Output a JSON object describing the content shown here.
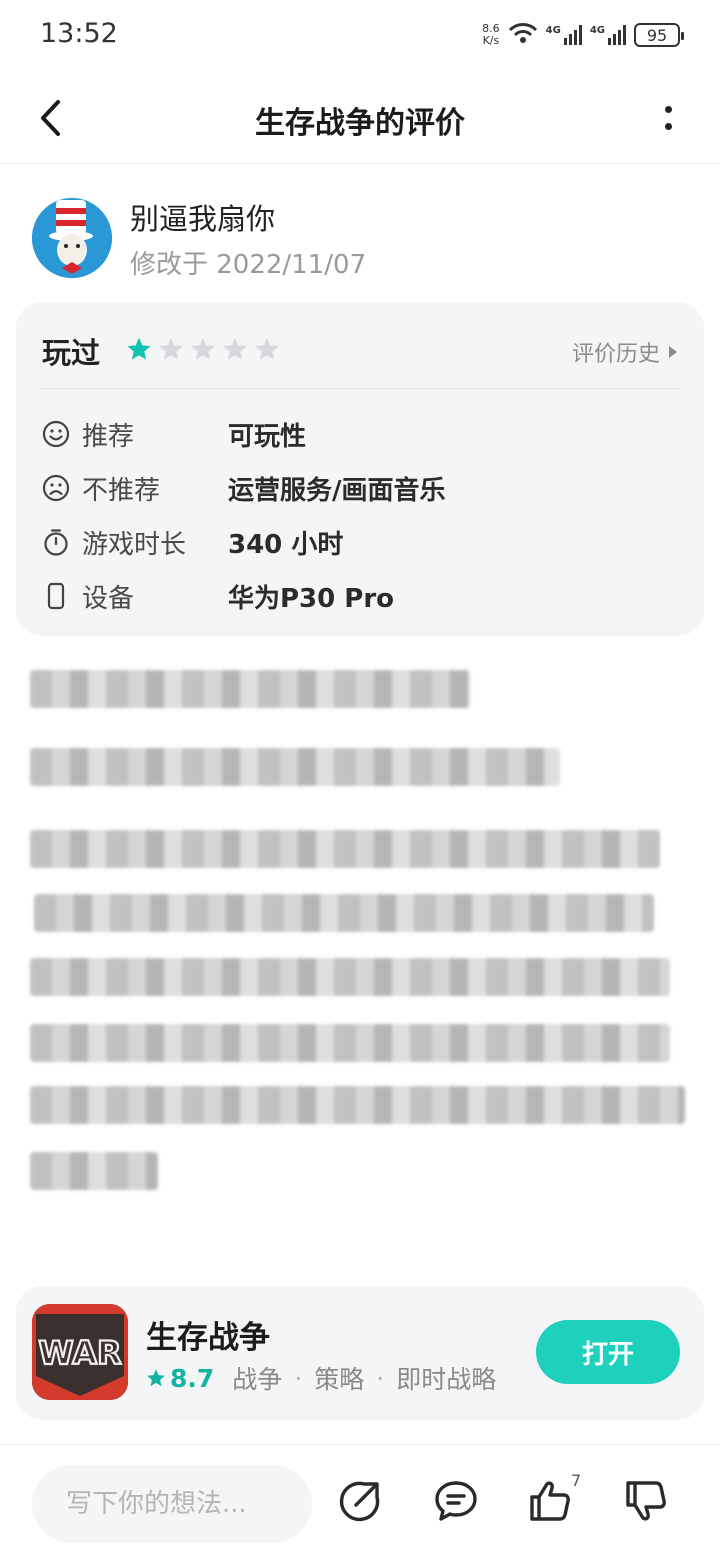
{
  "status_bar": {
    "time": "13:52",
    "net_speed_value": "8.6",
    "net_speed_unit": "K/s",
    "signal_1_label": "4G",
    "signal_2_label": "4G",
    "battery": "95"
  },
  "header": {
    "title": "生存战争的评价",
    "back_icon": "chevron-left-icon",
    "more_icon": "more-vertical-icon"
  },
  "author": {
    "name": "别逼我扇你",
    "date": "修改于 2022/11/07"
  },
  "review": {
    "status": "玩过",
    "rating": 1,
    "rating_max": 5,
    "history_label": "评价历史",
    "rows": [
      {
        "icon": "smile-icon",
        "label": "推荐",
        "value": "可玩性"
      },
      {
        "icon": "frown-icon",
        "label": "不推荐",
        "value": "运营服务/画面音乐"
      },
      {
        "icon": "timer-icon",
        "label": "游戏时长",
        "value": "340 小时"
      },
      {
        "icon": "phone-icon",
        "label": "设备",
        "value": "华为P30 Pro"
      }
    ]
  },
  "app": {
    "name": "生存战争",
    "rating": "8.7",
    "tags": [
      "战争",
      "策略",
      "即时战略"
    ],
    "open_label": "打开",
    "icon_text": "WAR"
  },
  "bottom_bar": {
    "placeholder": "写下你的想法...",
    "like_count": "7"
  },
  "colors": {
    "accent": "#1dd1bd",
    "star_active": "#12c2ad",
    "star_inactive": "#d6d8db"
  }
}
